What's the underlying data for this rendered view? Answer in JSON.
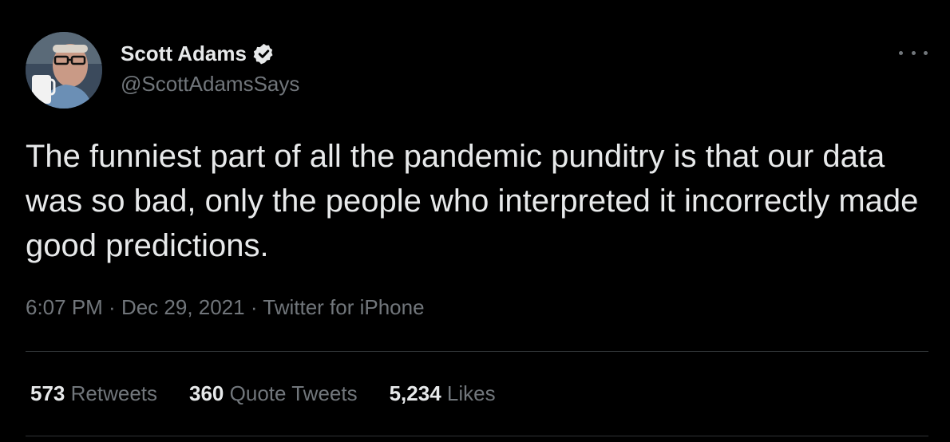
{
  "author": {
    "name": "Scott Adams",
    "handle": "@ScottAdamsSays",
    "verified": true,
    "avatar_icon": "avatar-photo"
  },
  "tweet": {
    "text": "The funniest part of all the pandemic punditry is that our data was so bad, only the people who interpreted it incorrectly made good predictions."
  },
  "meta": {
    "time": "6:07 PM",
    "separator1": " · ",
    "date": "Dec 29, 2021",
    "separator2": " · ",
    "source": "Twitter for iPhone"
  },
  "stats": [
    {
      "count": "573",
      "label": "Retweets"
    },
    {
      "count": "360",
      "label": "Quote Tweets"
    },
    {
      "count": "5,234",
      "label": "Likes"
    }
  ],
  "icons": {
    "verified": "verified-badge-icon",
    "more": "more-options-icon"
  },
  "colors": {
    "background": "#000000",
    "primary_text": "#e7e9ea",
    "secondary_text": "#71767b",
    "divider": "#2f3336"
  }
}
